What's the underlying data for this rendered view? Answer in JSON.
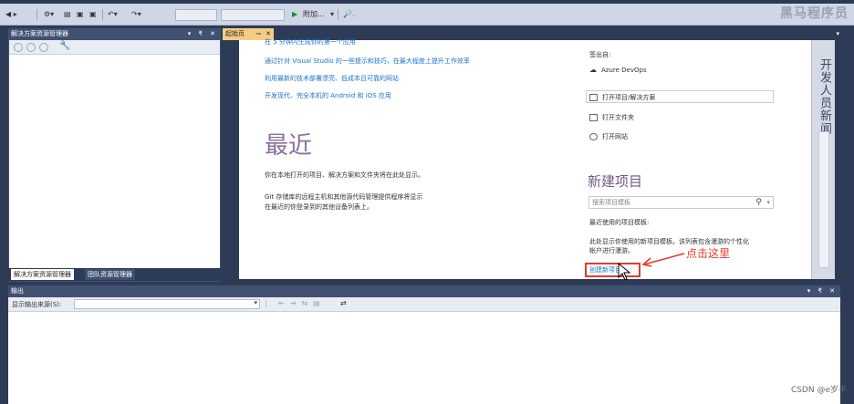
{
  "watermark_brand": "黑马程序员",
  "toolbar": {
    "attach_label": "附加...",
    "play_symbol": "▶"
  },
  "solution_explorer": {
    "title": "解决方案资源管理器",
    "controls": "▾ ₹ ✕",
    "tabs": [
      "解决方案资源管理器",
      "团队资源管理器"
    ]
  },
  "document": {
    "tab_label": "起始页",
    "tab_close": "✕",
    "links": [
      "在 5 分钟内生成你的第一个应用",
      "通过针对 Visual Studio 的一些提示和技巧，在最大程度上提升工作效率",
      "利用最新的技术部署漂亮、低成本且可靠的网站",
      "开发现代、完全本机的 Android 和 iOS 应用"
    ],
    "recent_heading": "最近",
    "recent_text_1": "你在本地打开的项目、解决方案和文件夹将在此处显示。",
    "recent_text_2a": "Git 存储库的远程主机和其他源代码管理提供程序将显示",
    "recent_text_2b": "在最近的你登录到的其他设备列表上。",
    "open_from_label": "签出自:",
    "azure_devops": "Azure DevOps",
    "open_project": "打开项目/解决方案",
    "open_folder": "打开文件夹",
    "open_website": "打开网站",
    "new_project_heading": "新建项目",
    "search_placeholder": "搜索项目模板",
    "recent_templates_label": "最近使用的项目模板:",
    "recent_templates_text_1": "此处显示你使用的新项目模板。该列表包含漫游的个性化",
    "recent_templates_text_2": "帐户进行漫游。",
    "create_new_project": "创建新项目...",
    "annotation": "点击这里",
    "side_panel_label": "开发人员新闻"
  },
  "output": {
    "title": "输出",
    "controls": "▾ ₹ ✕",
    "show_from_label": "显示输出来源(S):"
  },
  "footer_watermark": "CSDN @e岁半"
}
